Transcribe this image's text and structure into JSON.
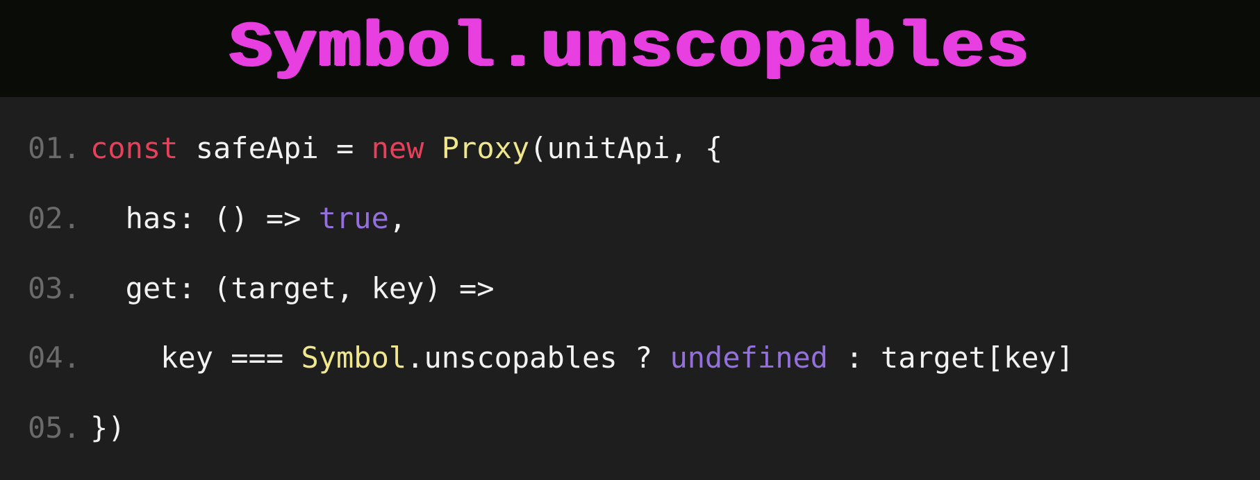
{
  "title": "Symbol.unscopables",
  "code": {
    "lines": [
      {
        "num": "01.",
        "tokens": [
          {
            "cls": "kw-decl",
            "text": "const"
          },
          {
            "cls": "code-text",
            "text": " safeApi "
          },
          {
            "cls": "punct",
            "text": "= "
          },
          {
            "cls": "kw-new",
            "text": "new"
          },
          {
            "cls": "code-text",
            "text": " "
          },
          {
            "cls": "cls",
            "text": "Proxy"
          },
          {
            "cls": "punct",
            "text": "(unitApi, {"
          }
        ]
      },
      {
        "num": "02.",
        "tokens": [
          {
            "cls": "code-text",
            "text": "  has: "
          },
          {
            "cls": "punct",
            "text": "() => "
          },
          {
            "cls": "lit",
            "text": "true"
          },
          {
            "cls": "punct",
            "text": ","
          }
        ]
      },
      {
        "num": "03.",
        "tokens": [
          {
            "cls": "code-text",
            "text": "  get: "
          },
          {
            "cls": "punct",
            "text": "(target, key) =>"
          }
        ]
      },
      {
        "num": "04.",
        "tokens": [
          {
            "cls": "code-text",
            "text": "    key "
          },
          {
            "cls": "punct",
            "text": "=== "
          },
          {
            "cls": "cls",
            "text": "Symbol"
          },
          {
            "cls": "code-text",
            "text": ".unscopables "
          },
          {
            "cls": "punct",
            "text": "? "
          },
          {
            "cls": "lit",
            "text": "undefined"
          },
          {
            "cls": "punct",
            "text": " : target[key]"
          }
        ]
      },
      {
        "num": "05.",
        "tokens": [
          {
            "cls": "punct",
            "text": "})"
          }
        ]
      }
    ]
  }
}
